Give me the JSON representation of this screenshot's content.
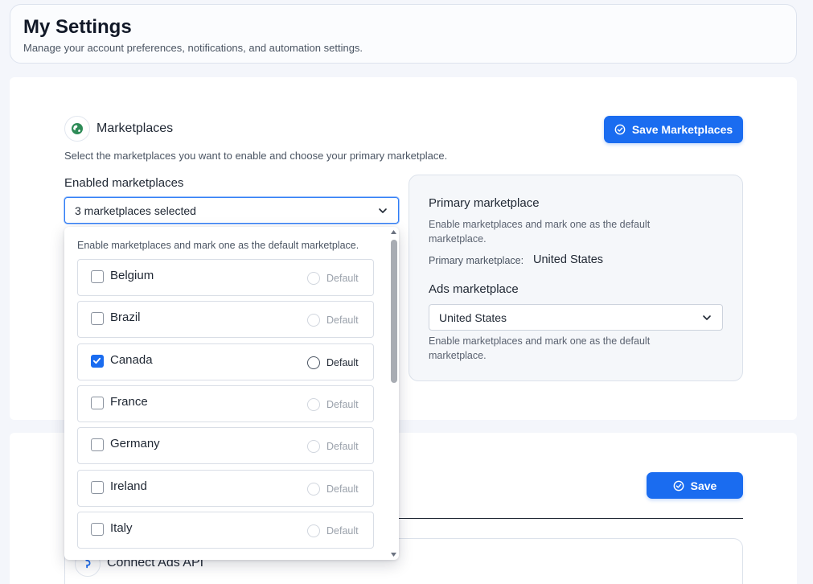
{
  "header": {
    "title": "My Settings",
    "subtitle": "Manage your account preferences, notifications, and automation settings."
  },
  "marketplaces": {
    "title": "Marketplaces",
    "description": "Select the marketplaces you want to enable and choose your primary marketplace.",
    "save_label": "Save Marketplaces",
    "enabled_label": "Enabled marketplaces",
    "select_value": "3 marketplaces selected",
    "dropdown": {
      "hint": "Enable marketplaces and mark one as the default marketplace.",
      "default_label": "Default",
      "items": [
        {
          "name": "Belgium",
          "checked": false
        },
        {
          "name": "Brazil",
          "checked": false
        },
        {
          "name": "Canada",
          "checked": true
        },
        {
          "name": "France",
          "checked": false
        },
        {
          "name": "Germany",
          "checked": false
        },
        {
          "name": "Ireland",
          "checked": false
        },
        {
          "name": "Italy",
          "checked": false
        }
      ]
    },
    "primary": {
      "title": "Primary marketplace",
      "hint": "Enable marketplaces and mark one as the default marketplace.",
      "current_label": "Primary marketplace:",
      "current_value": "United States"
    },
    "ads": {
      "title": "Ads marketplace",
      "select_value": "United States",
      "hint": "Enable marketplaces and mark one as the default marketplace."
    }
  },
  "section2": {
    "save_label": "Save",
    "ads_api_title": "Connect Ads API"
  },
  "colors": {
    "accent": "#1a6cf0",
    "background": "#f4f6fb"
  }
}
